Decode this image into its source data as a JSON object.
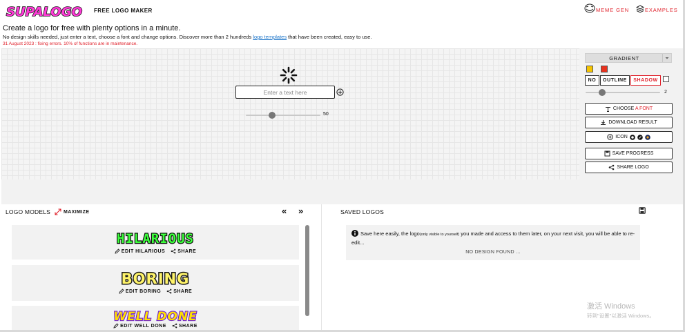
{
  "header": {
    "logo_text": "SUPALOGO",
    "tagline": "FREE LOGO MAKER",
    "nav": [
      {
        "label": "MEME GEN",
        "icon": "troll-face-icon"
      },
      {
        "label": "EXAMPLES",
        "icon": "layers-icon"
      }
    ]
  },
  "intro": {
    "title": "Create a logo for free with plenty options in a minute.",
    "desc_before": "No design skills needed, just enter a text, choose a font and change options. Discover more than 2 hundreds ",
    "desc_link": "logo templates",
    "desc_after": " that have been created, easy to use.",
    "notice": "31 August 2023 : fixing errors. 10% of functions are in maintenance."
  },
  "editor": {
    "placeholder": "Enter a text here",
    "size_value": "50",
    "size_fraction": 0.35
  },
  "panel": {
    "gradient_label": "GRADIENT",
    "swatch_colors": [
      "#f5c400",
      "#e8321e"
    ],
    "styles": [
      {
        "label": "NO",
        "active": false
      },
      {
        "label": "OUTLINE",
        "active": false
      },
      {
        "label": "SHADOW",
        "active": true
      }
    ],
    "option_value": "2",
    "option_fraction": 0.22,
    "choose_font_prefix": "CHOOSE ",
    "choose_font_highlight": "A FONT",
    "download": "DOWNLOAD RESULT",
    "icon_label": "ICON",
    "save_progress": "SAVE PROGRESS",
    "share_logo": "SHARE LOGO"
  },
  "models": {
    "title": "LOGO MODELS",
    "maximize": "MAXIMIZE",
    "prev": "«",
    "next": "»",
    "items": [
      {
        "name": "HILARIOUS",
        "edit": "EDIT HILARIOUS",
        "share": "SHARE",
        "fill": "#3cff3c",
        "stroke": "#0a0a0a"
      },
      {
        "name": "BORING",
        "edit": "EDIT BORING",
        "share": "SHARE",
        "fill": "#fff46a",
        "stroke": "#1a1a1a"
      },
      {
        "name": "WELL DONE",
        "edit": "EDIT WELL DONE",
        "share": "SHARE",
        "fill": "#ffe000",
        "stroke": "#6a1bd6"
      }
    ]
  },
  "saved": {
    "title": "SAVED LOGOS",
    "info_before": "Save here easily, the logo",
    "info_small": "(only visible to yourself)",
    "info_after": " you made and access to them later, on your next visit, you will be able to re-edit...",
    "empty": "NO DESIGN FOUND ..."
  },
  "watermark": {
    "line1": "激活 Windows",
    "line2": "转到\"设置\"以激活 Windows。"
  },
  "colors": {
    "accent_red": "#e0202a",
    "link_blue": "#1a73c8",
    "logo_fill": "#ff3ad7",
    "logo_stroke": "#1a1a1a"
  }
}
